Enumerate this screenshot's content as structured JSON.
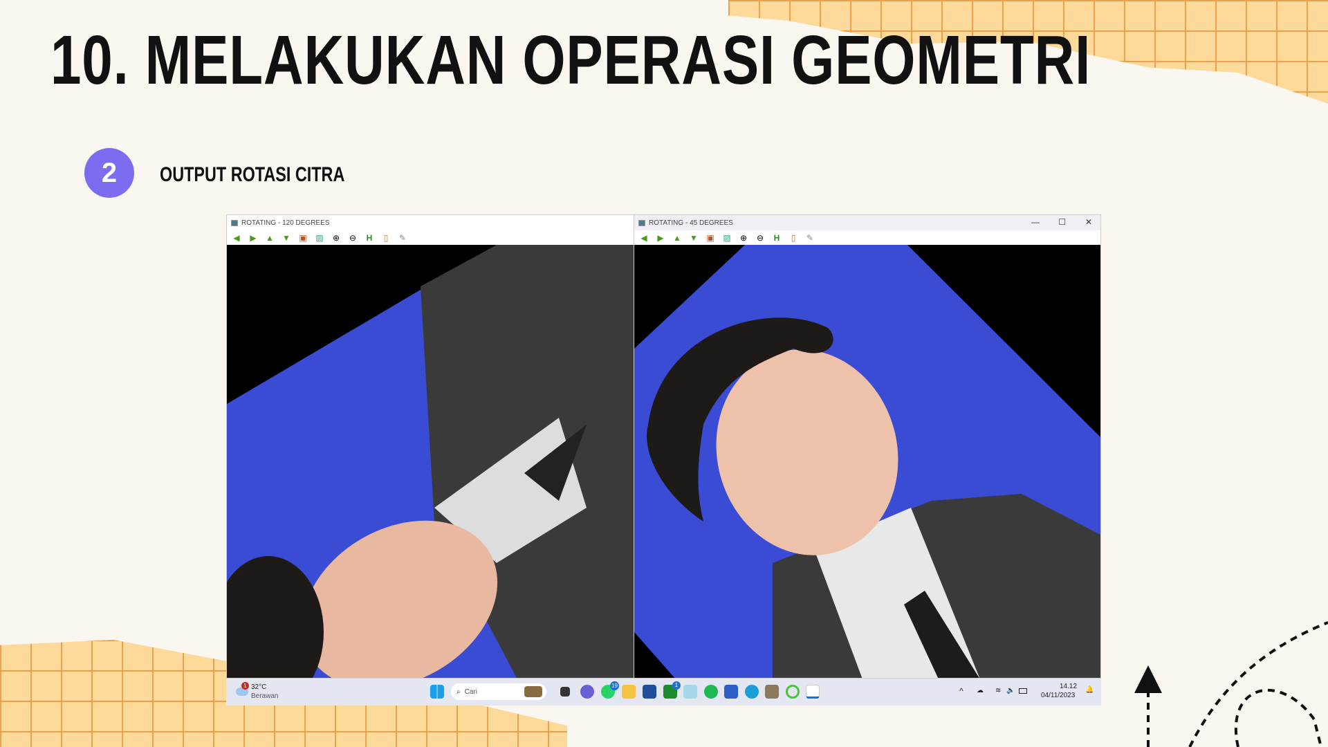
{
  "slide": {
    "title": "10. MELAKUKAN OPERASI GEOMETRI",
    "step_number": "2",
    "subtitle": "OUTPUT ROTASI CITRA"
  },
  "windows": [
    {
      "title": "ROTATING - 120 DEGREES"
    },
    {
      "title": "ROTATING - 45 DEGREES",
      "minimize": "—",
      "maximize": "☐",
      "close": "✕"
    }
  ],
  "toolbar": [
    "◀",
    "▶",
    "▲",
    "▼",
    "▣",
    "▨",
    "⊕",
    "⊖",
    "H",
    "▯",
    "✎"
  ],
  "taskbar": {
    "weather_temp": "32°C",
    "weather_desc": "Berawan",
    "weather_badge": "1",
    "search_placeholder": "Cari",
    "whatsapp_badge": "19",
    "xbox_badge": "1",
    "time": "14.12",
    "date": "04/11/2023"
  }
}
